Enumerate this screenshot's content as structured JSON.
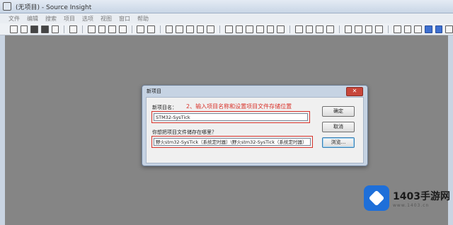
{
  "window": {
    "title": "(无项目) - Source Insight"
  },
  "menubar": {
    "items": [
      "文件",
      "编辑",
      "搜索",
      "项目",
      "选项",
      "视图",
      "窗口",
      "帮助"
    ]
  },
  "dialog": {
    "title": "新项目",
    "close_label": "✕",
    "name_label": "新项目名：",
    "annotation": "2、输入项目名称和设置项目文件存储位置",
    "name_value": "STM32-SysTick",
    "location_label": "你想把项目文件储存在哪里？",
    "location_value": "野火stm32-SysTick（系统定时器）\\野火stm32-SysTick（系统定时器）",
    "ok_label": "确定",
    "cancel_label": "取消",
    "browse_label": "浏览..."
  },
  "watermark": {
    "brand": "1403手游网",
    "url": "www.1403.cn"
  },
  "colors": {
    "annotation_red": "#d8322a",
    "close_red": "#c7463a",
    "watermark_blue": "#1e6fd9"
  }
}
